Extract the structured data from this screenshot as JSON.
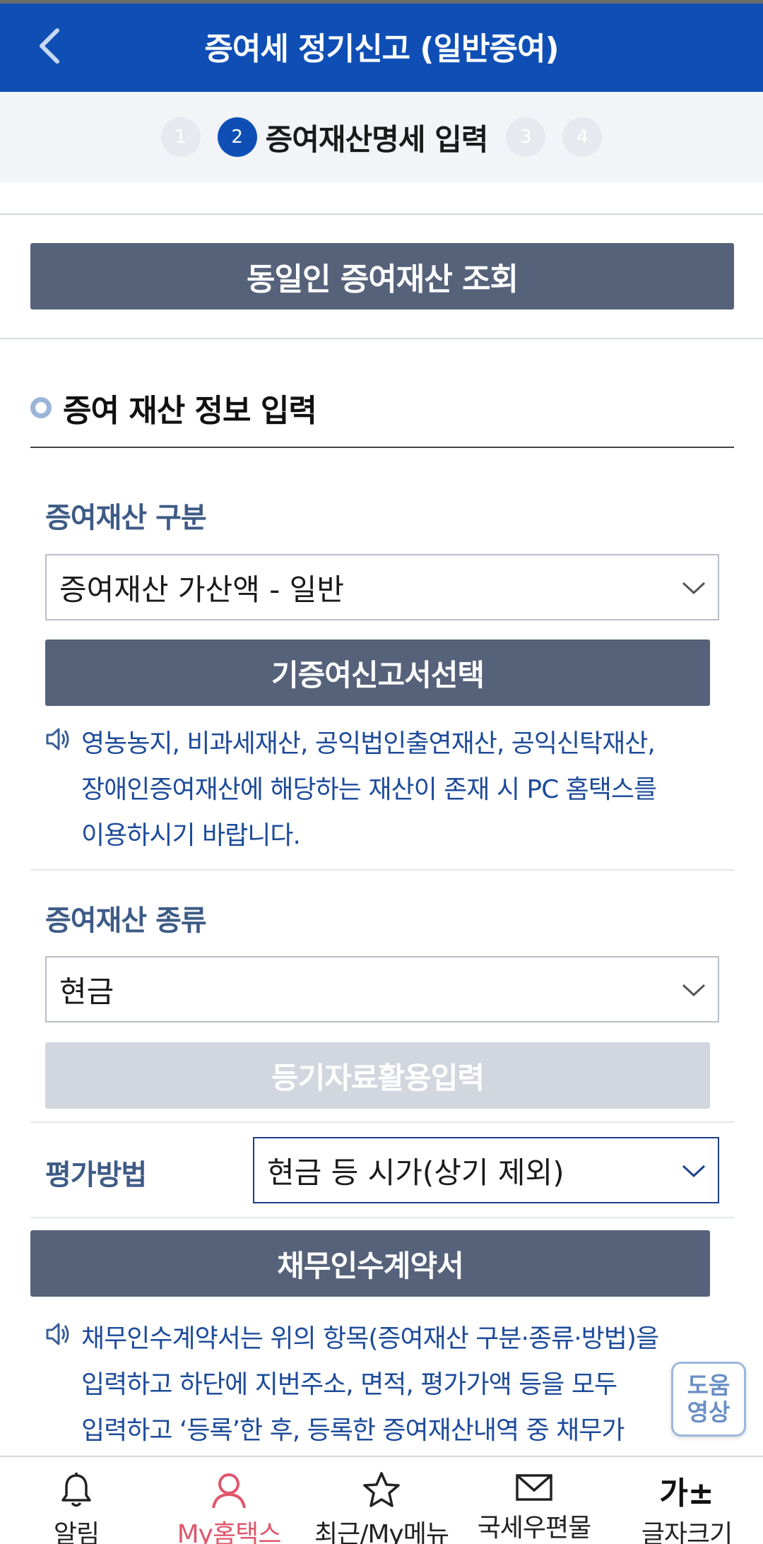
{
  "header": {
    "title": "증여세 정기신고 (일반증여)"
  },
  "steps": {
    "items": [
      "1",
      "2",
      "3",
      "4"
    ],
    "active_label": "증여재산명세 입력"
  },
  "lookup_button": "동일인 증여재산 조회",
  "section_title": "증여 재산 정보 입력",
  "category": {
    "label": "증여재산 구분",
    "value": "증여재산 가산액 - 일반"
  },
  "prior_report_button": "기증여신고서선택",
  "notice1": {
    "lines": [
      "영농농지, 비과세재산, 공익법인출연재산, 공익신탁재산,",
      "장애인증여재산에 해당하는 재산이 존재 시 PC 홈택스를",
      "이용하시기 바랍니다."
    ]
  },
  "type": {
    "label": "증여재산 종류",
    "value": "현금"
  },
  "registry_button": "등기자료활용입력",
  "valuation": {
    "label": "평가방법",
    "value": "현금 등 시가(상기 제외)"
  },
  "debt_button": "채무인수계약서",
  "notice2": {
    "lines": [
      "채무인수계약서는 위의 항목(증여재산 구분·종류·방법)을",
      "입력하고 하단에 지번주소, 면적, 평가가액 등을 모두",
      "입력하고 ‘등록’한 후, 등록한 증여재산내역 중 채무가"
    ]
  },
  "help": {
    "line1": "도움",
    "line2": "영상"
  },
  "bottom_nav": {
    "items": [
      {
        "label": "알림",
        "icon": "bell-icon"
      },
      {
        "label": "My홈택스",
        "icon": "person-icon"
      },
      {
        "label": "최근/My메뉴",
        "icon": "star-icon"
      },
      {
        "label": "국세우편물",
        "icon": "mail-icon"
      },
      {
        "label": "글자크기",
        "icon": "font-size-icon",
        "icon_text": "가±"
      }
    ],
    "active_index": 1
  },
  "colors": {
    "primary": "#0f4fb5",
    "button_dark": "#56627a",
    "active_nav": "#e0566b",
    "notice_text": "#1d4b9a"
  }
}
